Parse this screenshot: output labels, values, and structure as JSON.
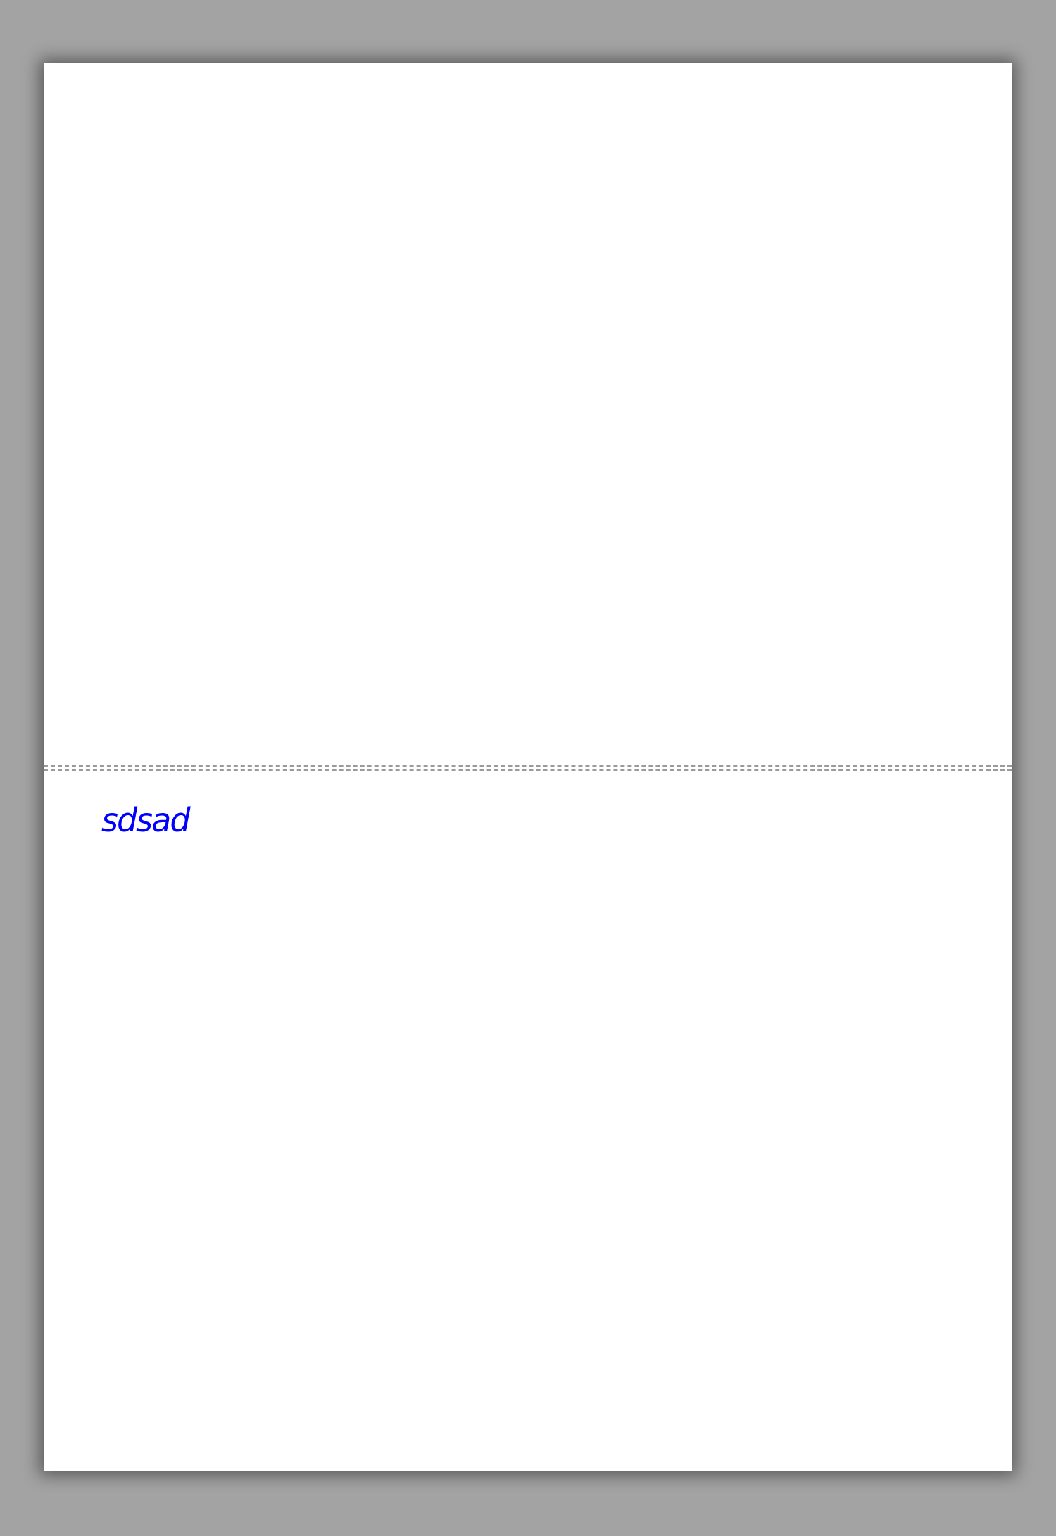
{
  "document": {
    "note_text": "sdsad",
    "note_color": "#0000ff"
  }
}
